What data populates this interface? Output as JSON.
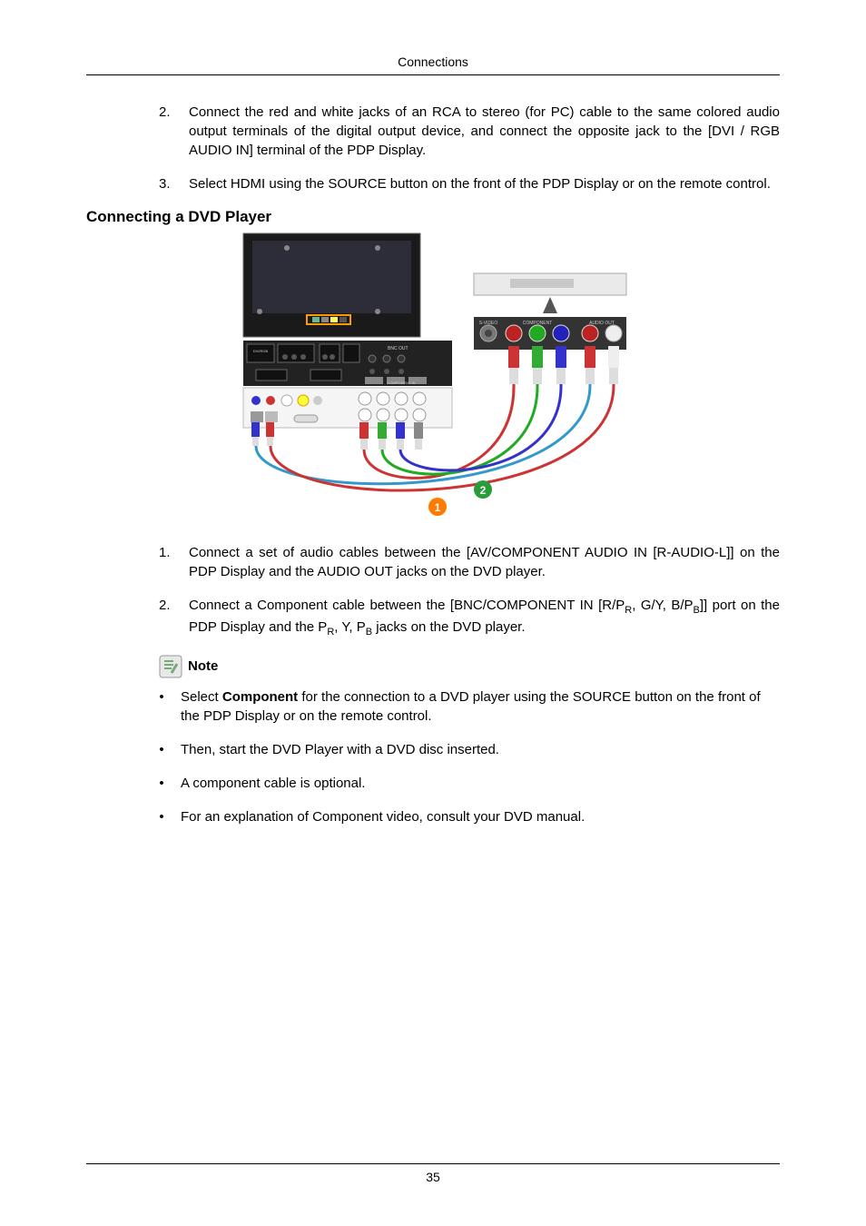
{
  "header": "Connections",
  "preSteps": [
    {
      "num": "2.",
      "text": "Connect the red and white jacks of an RCA to stereo (for PC) cable to the same colored audio output terminals of the digital output device, and connect the opposite jack to the [DVI / RGB AUDIO IN] terminal of the PDP Display."
    },
    {
      "num": "3.",
      "text": "Select HDMI using the SOURCE button on the front of the PDP Display or on the remote control."
    }
  ],
  "sectionTitle": "Connecting a DVD Player",
  "postSteps": [
    {
      "num": "1.",
      "text": "Connect a set of audio cables between the [AV/COMPONENT AUDIO IN [R-AUDIO-L]] on the PDP Display and the AUDIO OUT jacks on the DVD player."
    },
    {
      "num": "2.",
      "text_pre": "Connect a Component cable between the [BNC/COMPONENT IN [R/P",
      "sub1": "R",
      "mid1": ", G/Y, B/P",
      "sub2": "B",
      "mid2": "]] port on the PDP Display and the P",
      "sub3": "R",
      "mid3": ", Y, P",
      "sub4": "B",
      "text_post": " jacks on the DVD player."
    }
  ],
  "noteLabel": "Note",
  "notes": [
    {
      "pre": "Select ",
      "bold": "Component",
      "post": " for the connection to a DVD player using the SOURCE button on the front of the PDP Display or on the remote control."
    },
    {
      "pre": "",
      "bold": "",
      "post": "Then, start the DVD Player with a DVD disc inserted."
    },
    {
      "pre": "",
      "bold": "",
      "post": "A component cable is optional."
    },
    {
      "pre": "",
      "bold": "",
      "post": "For an explanation of Component video, consult your DVD manual."
    }
  ],
  "pageNumber": "35"
}
